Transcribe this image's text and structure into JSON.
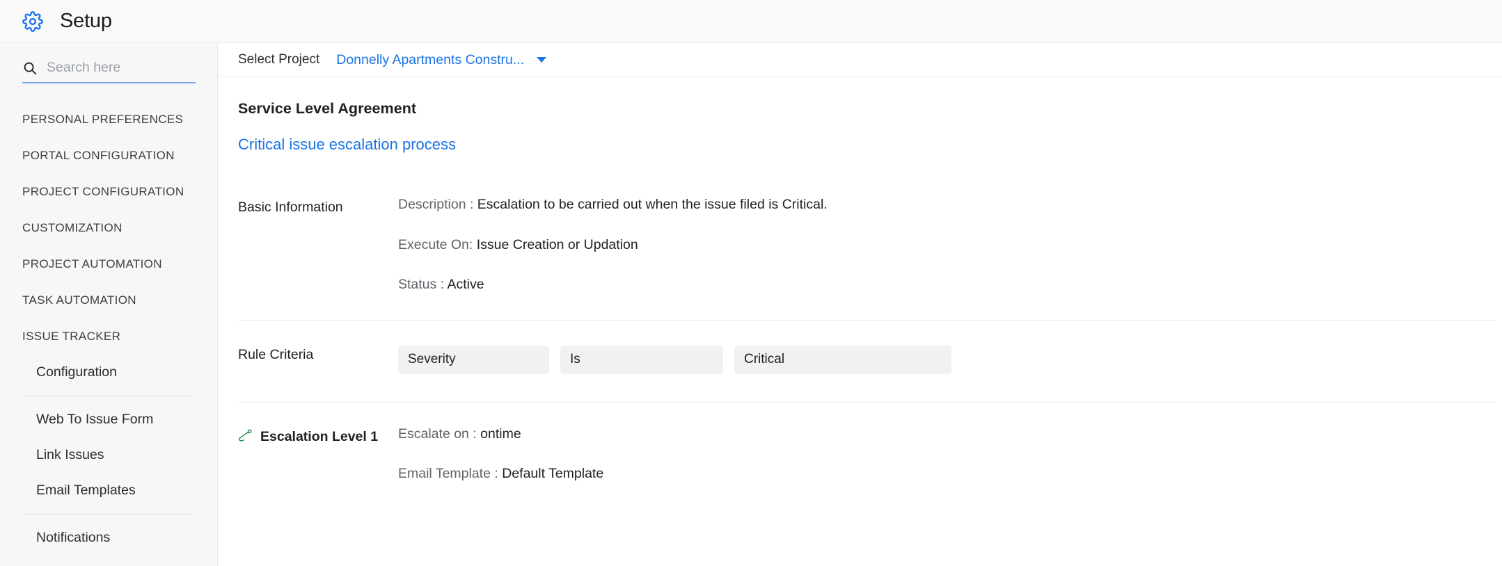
{
  "header": {
    "title": "Setup",
    "gear_icon": "gear-icon",
    "accent": "#1a73e8"
  },
  "sidebar": {
    "search": {
      "placeholder": "Search here",
      "value": "",
      "icon": "search-icon"
    },
    "groups": [
      {
        "label": "PERSONAL PREFERENCES"
      },
      {
        "label": "PORTAL CONFIGURATION"
      },
      {
        "label": "PROJECT CONFIGURATION"
      },
      {
        "label": "CUSTOMIZATION"
      },
      {
        "label": "PROJECT AUTOMATION"
      },
      {
        "label": "TASK AUTOMATION"
      },
      {
        "label": "ISSUE TRACKER"
      }
    ],
    "sub_items_a": [
      {
        "label": "Configuration"
      }
    ],
    "sub_items_b": [
      {
        "label": "Web To Issue Form"
      },
      {
        "label": "Link Issues"
      },
      {
        "label": "Email Templates"
      }
    ],
    "sub_items_c": [
      {
        "label": "Notifications"
      }
    ]
  },
  "project_bar": {
    "label": "Select Project",
    "selected": "Donnelly Apartments Constru...",
    "caret_icon": "chevron-down-icon"
  },
  "main": {
    "page_title": "Service Level Agreement",
    "rule_link": "Critical issue escalation process",
    "basic_information": {
      "section_label": "Basic Information",
      "description_label": "Description :",
      "description_value": "Escalation to be carried out when the issue filed is Critical.",
      "execute_on_label": "Execute On:",
      "execute_on_value": "Issue Creation or Updation",
      "status_label": "Status :",
      "status_value": "Active"
    },
    "rule_criteria": {
      "section_label": "Rule Criteria",
      "field": "Severity",
      "operator": "Is",
      "value": "Critical"
    },
    "escalation_level_1": {
      "section_label": "Escalation Level 1",
      "icon": "escalator-icon",
      "icon_color": "#1a8a43",
      "escalate_on_label": "Escalate on :",
      "escalate_on_value": "ontime",
      "email_template_label": "Email Template :",
      "email_template_value": "Default Template"
    }
  }
}
